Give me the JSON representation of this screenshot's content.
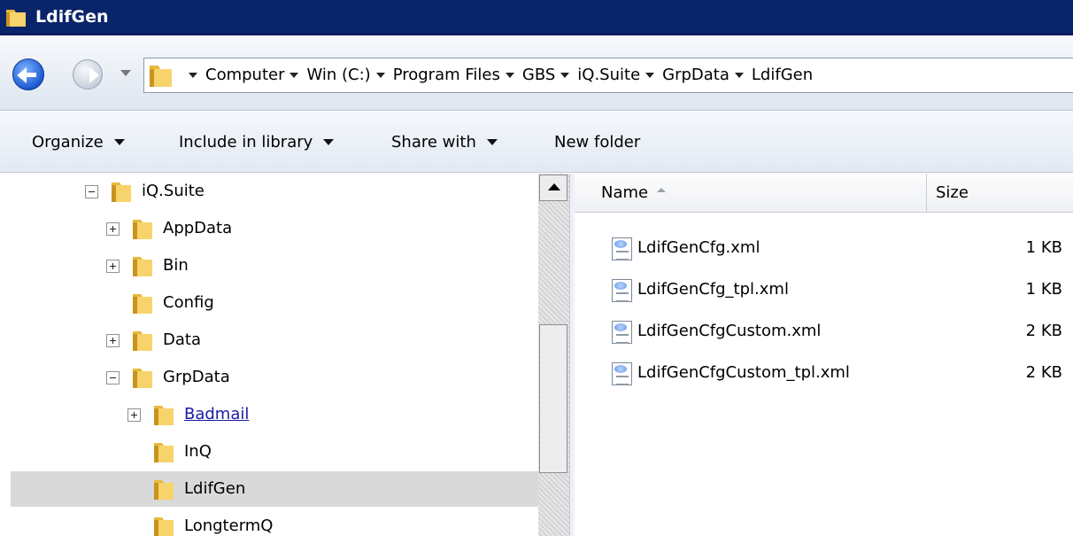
{
  "window": {
    "title": "LdifGen"
  },
  "address": {
    "breadcrumbs": [
      "Computer",
      "Win (C:)",
      "Program Files",
      "GBS",
      "iQ.Suite",
      "GrpData",
      "LdifGen"
    ]
  },
  "toolbar": {
    "organize": "Organize",
    "include_in_library": "Include in library",
    "share_with": "Share with",
    "new_folder": "New folder"
  },
  "tree": [
    {
      "label": "iQ.Suite",
      "expander": "minus"
    },
    {
      "label": "AppData",
      "expander": "plus"
    },
    {
      "label": "Bin",
      "expander": "plus"
    },
    {
      "label": "Config",
      "expander": "none"
    },
    {
      "label": "Data",
      "expander": "plus"
    },
    {
      "label": "GrpData",
      "expander": "minus"
    },
    {
      "label": "Badmail",
      "expander": "plus",
      "hovered": true
    },
    {
      "label": "InQ",
      "expander": "none"
    },
    {
      "label": "LdifGen",
      "expander": "none",
      "selected": true
    },
    {
      "label": "LongtermQ",
      "expander": "none"
    }
  ],
  "columns": {
    "name": "Name",
    "size": "Size"
  },
  "files": [
    {
      "name": "LdifGenCfg.xml",
      "size": "1 KB"
    },
    {
      "name": "LdifGenCfg_tpl.xml",
      "size": "1 KB"
    },
    {
      "name": "LdifGenCfgCustom.xml",
      "size": "2 KB"
    },
    {
      "name": "LdifGenCfgCustom_tpl.xml",
      "size": "2 KB"
    }
  ],
  "colors": {
    "titlebar": "#0a246a",
    "selection": "#d9d9d9",
    "link": "#1a1aa8",
    "folder": "#e8b93a"
  },
  "icons": {
    "folder": "folder-icon",
    "xml_file": "xml-file-icon",
    "back": "back-arrow-icon",
    "forward": "forward-arrow-icon"
  }
}
